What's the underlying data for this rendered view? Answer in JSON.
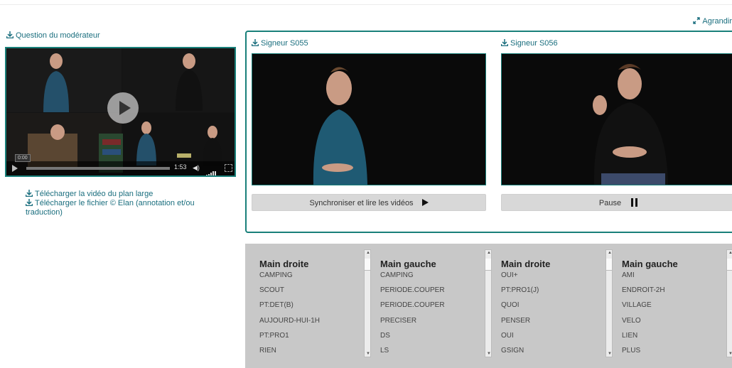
{
  "header": {
    "expand_label": "Agrandir"
  },
  "left": {
    "moderator_link": "Question du modérateur",
    "player": {
      "current_time": "0:00",
      "duration": "1:53",
      "progress": 0.0
    },
    "download_video": "Télécharger la vidéo du plan large",
    "download_file": "Télécharger le fichier © Elan (annotation et/ou traduction)"
  },
  "videos": [
    {
      "title": "Signeur S055",
      "button_label": "Synchroniser et lire les vidéos"
    },
    {
      "title": "Signeur S056",
      "button_label": "Pause"
    }
  ],
  "annotations": [
    {
      "heading": "Main droite",
      "items": [
        "CAMPING",
        "SCOUT",
        "PT:DET(B)",
        "AUJOURD-HUI-1H",
        "PT:PRO1",
        "RIEN"
      ]
    },
    {
      "heading": "Main gauche",
      "items": [
        "CAMPING",
        "PERIODE.COUPER",
        "PERIODE.COUPER",
        "PRECISER",
        "DS",
        "LS"
      ]
    },
    {
      "heading": "Main droite",
      "items": [
        "OUI+",
        "PT:PRO1(J)",
        "QUOI",
        "PENSER",
        "OUI",
        "GSIGN"
      ]
    },
    {
      "heading": "Main gauche",
      "items": [
        "AMI",
        "ENDROIT-2H",
        "VILLAGE",
        "VELO",
        "LIEN",
        "PLUS"
      ]
    }
  ],
  "colors": {
    "accent": "#19807a",
    "link": "#1a6e7e",
    "panel_gray": "#c8c8c8"
  },
  "icons": {
    "download": "download-icon",
    "expand": "expand-arrows-icon",
    "play": "play-icon",
    "pause": "pause-icon"
  }
}
